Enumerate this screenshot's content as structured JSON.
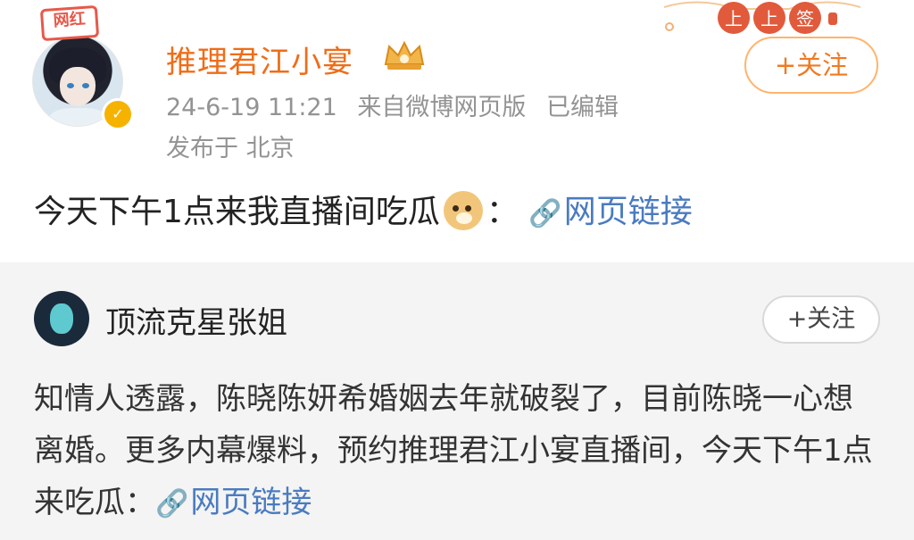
{
  "post": {
    "badge": "网红",
    "username": "推理君江小宴",
    "timestamp": "24-6-19 11:21",
    "source": "来自微博网页版",
    "edited": "已编辑",
    "location": "发布于 北京",
    "follow_label": "+关注",
    "deco_labels": [
      "上",
      "上",
      "签"
    ],
    "text": "今天下午1点来我直播间吃瓜",
    "after_emoji": "：",
    "link_label": "网页链接",
    "emoji_name": "doge-emoji"
  },
  "repost": {
    "username": "顶流克星张姐",
    "follow_label": "+关注",
    "text_before_link": "知情人透露，陈晓陈妍希婚姻去年就破裂了，目前陈晓一心想离婚。更多内幕爆料，预约推理君江小宴直播间，今天下午1点来吃瓜：",
    "link_label": "网页链接"
  },
  "colors": {
    "username": "#f06c18",
    "meta": "#939393",
    "link": "#4a7bc0",
    "follow_border": "#ffb46b",
    "repost_bg": "#f4f4f4"
  }
}
